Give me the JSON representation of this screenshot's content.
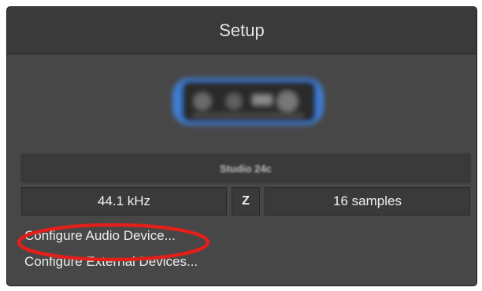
{
  "window": {
    "title": "Setup"
  },
  "device": {
    "name": "Studio 24c",
    "image_icon": "audio-interface-icon"
  },
  "settings": {
    "sample_rate": "44.1 kHz",
    "link_symbol": "Z",
    "buffer_size": "16 samples"
  },
  "links": {
    "configure_audio": "Configure Audio Device...",
    "configure_external": "Configure External Devices..."
  },
  "colors": {
    "panel_bg": "#474747",
    "header_bg": "#3a3a3a",
    "annotation_red": "#e0201b"
  }
}
